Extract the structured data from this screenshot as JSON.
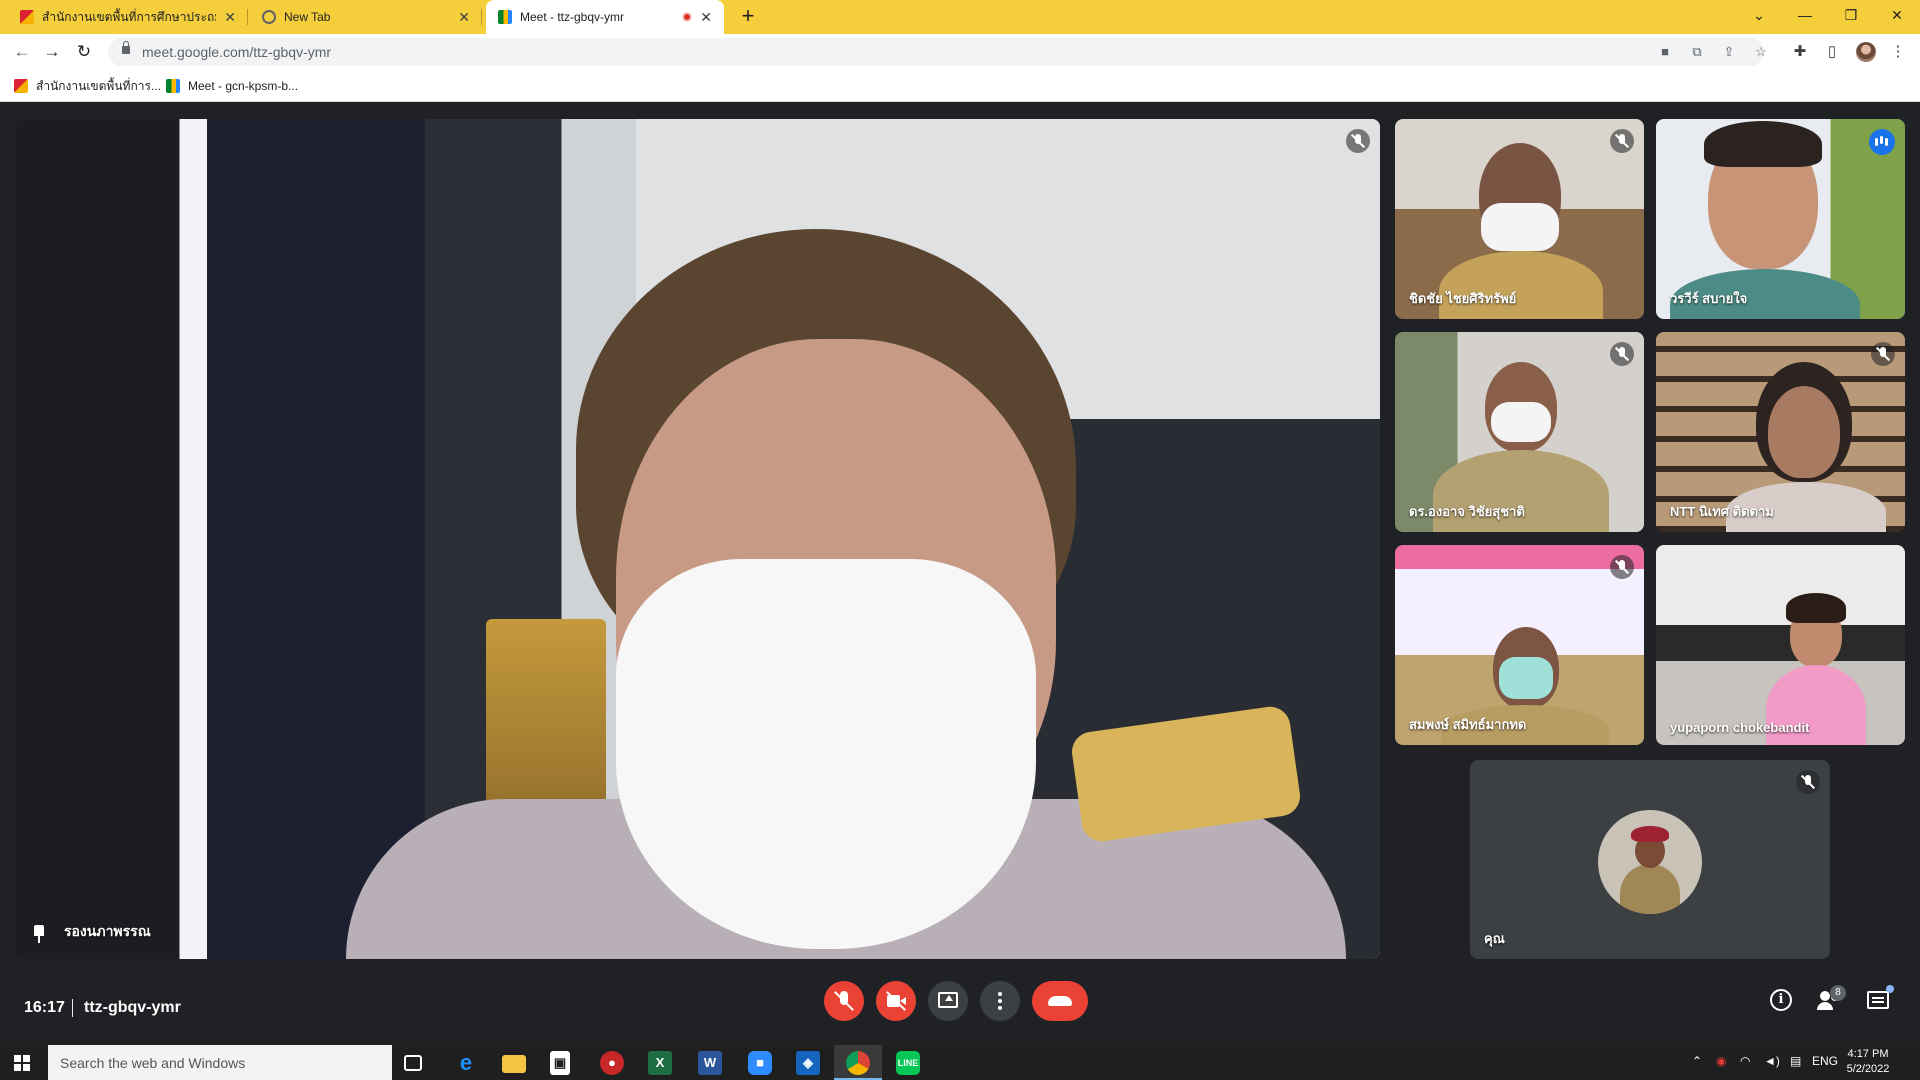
{
  "browser": {
    "tabs": [
      {
        "title": "สำนักงานเขตพื้นที่การศึกษาประถมศึกษ",
        "icon": "kps-logo-icon"
      },
      {
        "title": "New Tab",
        "icon": "globe-icon"
      },
      {
        "title": "Meet - ttz-gbqv-ymr",
        "icon": "google-meet-icon",
        "recording": true
      }
    ],
    "new_tab_symbol": "+",
    "window_controls": {
      "tab_search": "⌄",
      "minimize": "—",
      "restore": "❐",
      "close": "✕"
    },
    "url": "meet.google.com/ttz-gbqv-ymr",
    "bookmarks": [
      {
        "label": "สำนักงานเขตพื้นที่การ...",
        "icon": "kps-logo-icon"
      },
      {
        "label": "Meet - gcn-kpsm-b...",
        "icon": "google-meet-icon"
      }
    ]
  },
  "meet": {
    "main": {
      "name": "รองนภาพรรณ",
      "pinned": true,
      "muted": true
    },
    "participants": [
      {
        "name": "ชิดชัย ไชยศิริทรัพย์",
        "muted": true,
        "speaking": false
      },
      {
        "name": "วรวีร์ สบายใจ",
        "muted": false,
        "speaking": true
      },
      {
        "name": "ดร.องอาจ วิชัยสุชาติ",
        "muted": true,
        "speaking": false
      },
      {
        "name": "NTT นิเทศ ติดตาม",
        "muted": true,
        "speaking": false
      },
      {
        "name": "สมพงษ์ สมิทธ์มากทด",
        "muted": true,
        "speaking": false
      },
      {
        "name": "yupaporn chokebandit",
        "muted": false,
        "speaking": false
      }
    ],
    "self": {
      "name": "คุณ",
      "muted": true
    },
    "clock": "16:17",
    "meeting_code": "ttz-gbqv-ymr",
    "people_count": "8",
    "controls": {
      "mic": "microphone-off-icon",
      "camera": "camera-off-icon",
      "present": "present-screen-icon",
      "more": "more-options-icon",
      "leave": "leave-call-icon"
    },
    "colors": {
      "end_call": "#ea4335",
      "speaker_ring": "#8ab4f8",
      "background": "#202124"
    }
  },
  "taskbar": {
    "search_placeholder": "Search the web and Windows",
    "apps": [
      "task-view-icon",
      "edge-icon",
      "file-explorer-icon",
      "store-icon",
      "app-icon",
      "excel-icon",
      "word-icon",
      "zoom-icon",
      "defender-icon",
      "chrome-icon",
      "line-icon"
    ],
    "language": "ENG",
    "time": "4:17 PM",
    "date": "5/2/2022"
  }
}
